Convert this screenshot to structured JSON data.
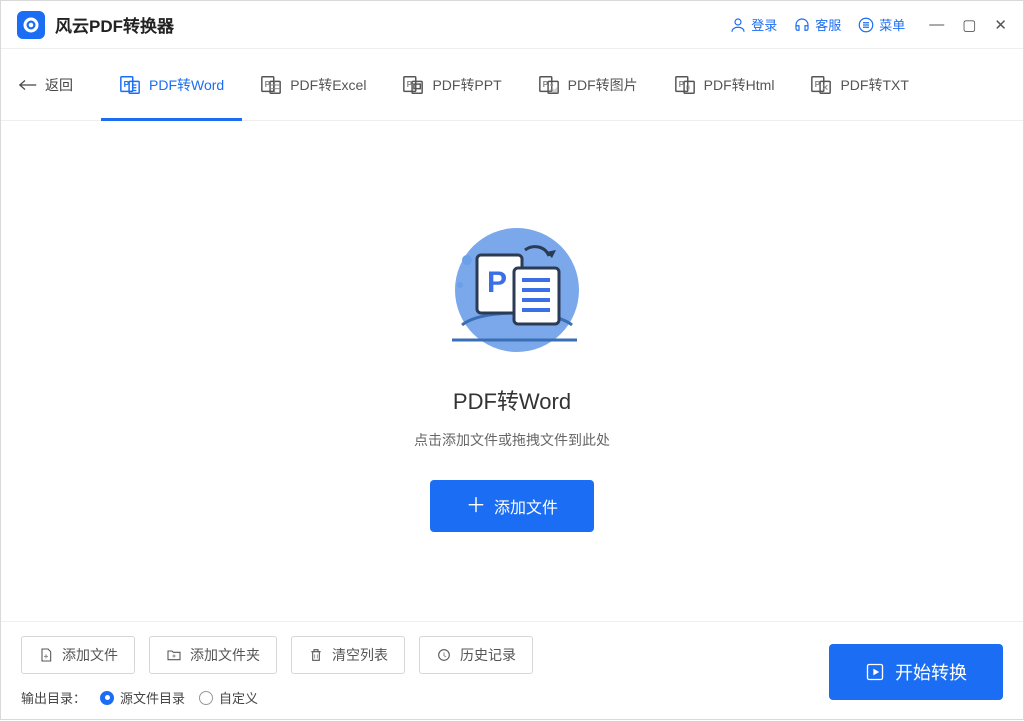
{
  "titlebar": {
    "app_name": "风云PDF转换器",
    "login": "登录",
    "support": "客服",
    "menu": "菜单"
  },
  "tabs": {
    "back": "返回",
    "items": [
      {
        "label": "PDF转Word",
        "active": true
      },
      {
        "label": "PDF转Excel"
      },
      {
        "label": "PDF转PPT"
      },
      {
        "label": "PDF转图片"
      },
      {
        "label": "PDF转Html"
      },
      {
        "label": "PDF转TXT"
      }
    ]
  },
  "main": {
    "title": "PDF转Word",
    "subtitle": "点击添加文件或拖拽文件到此处",
    "add_button": "添加文件"
  },
  "footer": {
    "btn_add_file": "添加文件",
    "btn_add_folder": "添加文件夹",
    "btn_clear": "清空列表",
    "btn_history": "历史记录",
    "output_label": "输出目录：",
    "radio_source": "源文件目录",
    "radio_custom": "自定义",
    "start": "开始转换"
  }
}
